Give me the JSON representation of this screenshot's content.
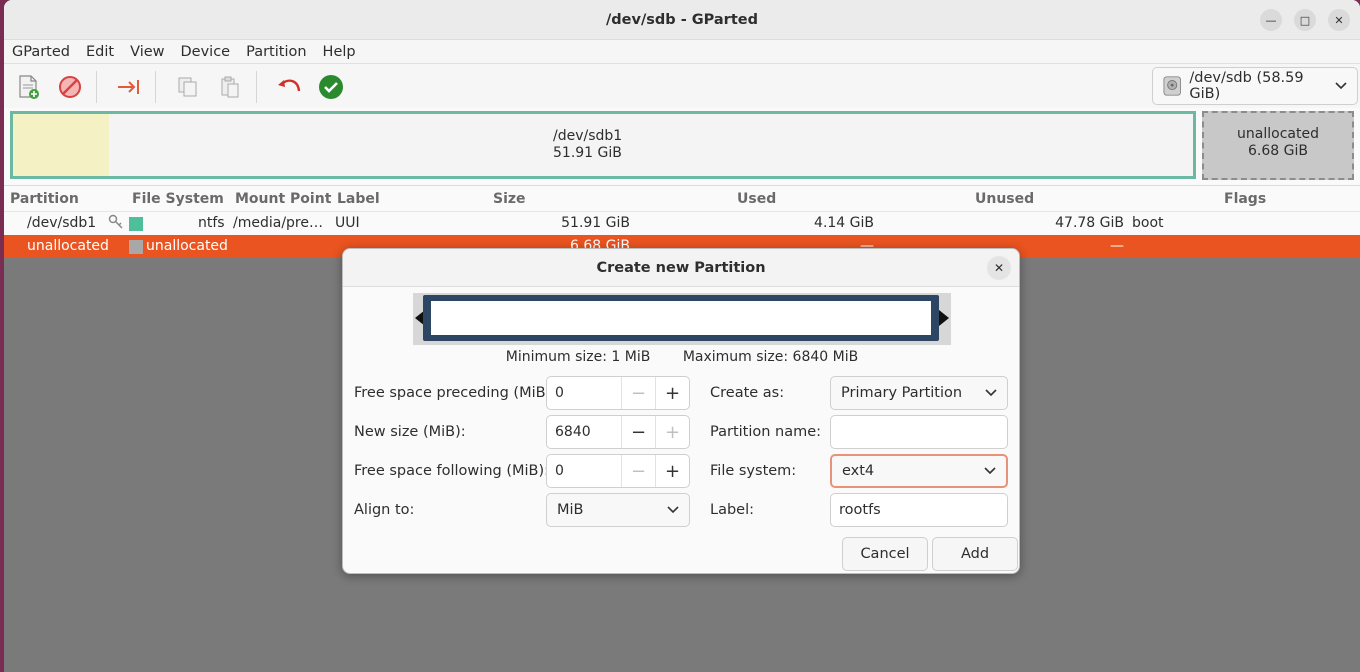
{
  "window": {
    "title": "/dev/sdb - GParted"
  },
  "menubar": {
    "items": [
      "GParted",
      "Edit",
      "View",
      "Device",
      "Partition",
      "Help"
    ]
  },
  "toolbar": {
    "device_label": "/dev/sdb (58.59 GiB)"
  },
  "diskmap": {
    "partitions": [
      {
        "name": "/dev/sdb1",
        "size": "51.91 GiB",
        "used_fraction": 0.08
      },
      {
        "name": "unallocated",
        "size": "6.68 GiB"
      }
    ]
  },
  "table": {
    "headers": [
      "Partition",
      "File System",
      "Mount Point",
      "Label",
      "Size",
      "Used",
      "Unused",
      "Flags"
    ],
    "rows": [
      {
        "partition": "/dev/sdb1",
        "filesystem": "ntfs",
        "mount": "/media/pre…",
        "label": "UUI",
        "size": "51.91 GiB",
        "used": "4.14 GiB",
        "unused": "47.78 GiB",
        "flags": "boot",
        "fs_color": "#4fbf9b"
      },
      {
        "partition": "unallocated",
        "filesystem": "unallocated",
        "mount": "",
        "label": "",
        "size": "6.68 GiB",
        "used": "—",
        "unused": "—",
        "flags": "",
        "fs_color": "#a8a8a8"
      }
    ]
  },
  "dialog": {
    "title": "Create new Partition",
    "min_size": "Minimum size: 1 MiB",
    "max_size": "Maximum size: 6840 MiB",
    "fields": {
      "preceding_label": "Free space preceding (MiB):",
      "preceding_value": "0",
      "new_size_label": "New size (MiB):",
      "new_size_value": "6840",
      "following_label": "Free space following (MiB):",
      "following_value": "0",
      "align_label": "Align to:",
      "align_value": "MiB",
      "create_as_label": "Create as:",
      "create_as_value": "Primary Partition",
      "partition_name_label": "Partition name:",
      "partition_name_value": "",
      "filesystem_label": "File system:",
      "filesystem_value": "ext4",
      "label_label": "Label:",
      "label_value": "rootfs"
    },
    "buttons": {
      "cancel": "Cancel",
      "add": "Add"
    }
  },
  "colors": {
    "accent": "#e95420",
    "partition_border": "#6bb8a3",
    "resizer_frame": "#2c4663"
  }
}
